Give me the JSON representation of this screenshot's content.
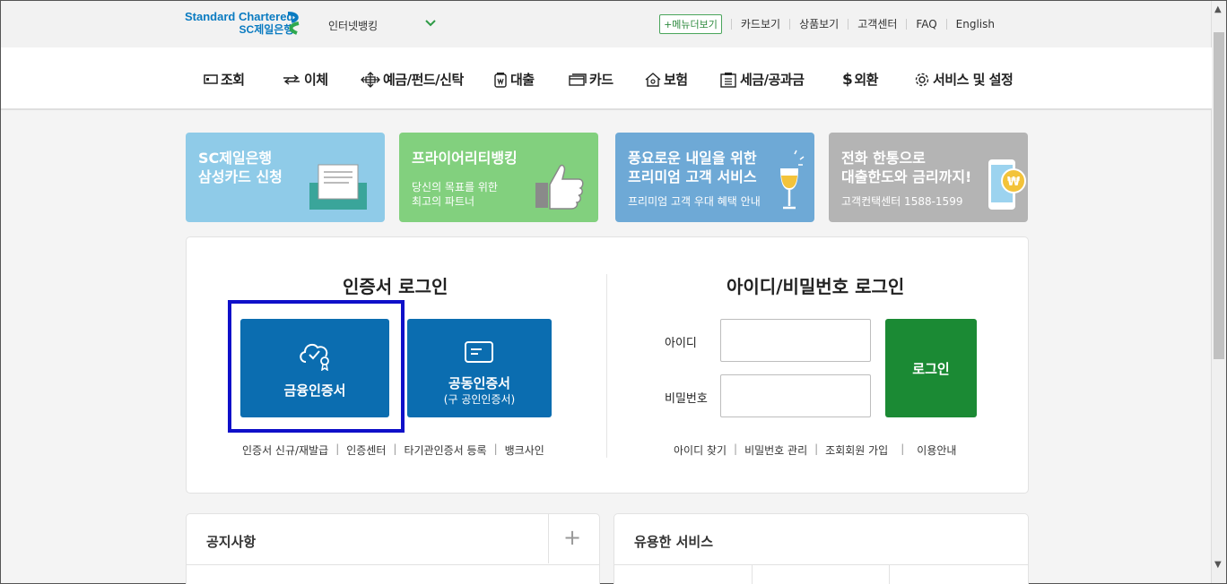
{
  "header": {
    "logo_line1": "Standard Chartered",
    "logo_line2": "SC제일은행",
    "site_select": "인터넷뱅킹",
    "menu_button": "+메뉴더보기",
    "util_links": [
      "카드보기",
      "상품보기",
      "고객센터",
      "FAQ",
      "English"
    ]
  },
  "gnb": [
    {
      "label": "조회",
      "icon": "screen-icon"
    },
    {
      "label": "이체",
      "icon": "transfer-arrows-icon"
    },
    {
      "label": "예금/펀드/신탁",
      "icon": "move-arrows-icon"
    },
    {
      "label": "대출",
      "icon": "won-jar-icon"
    },
    {
      "label": "카드",
      "icon": "card-icon"
    },
    {
      "label": "보험",
      "icon": "house-icon"
    },
    {
      "label": "세금/공과금",
      "icon": "tax-building-icon"
    },
    {
      "label": "외환",
      "icon": "dollar-icon"
    },
    {
      "label": "서비스 및 설정",
      "icon": "gear-icon"
    }
  ],
  "banners": [
    {
      "title1": "SC제일은행",
      "title2": "삼성카드 신청",
      "sub1": "",
      "sub2": "",
      "color": "#8fcbe8"
    },
    {
      "title1": "프라이어리티뱅킹",
      "title2": "",
      "sub1": "당신의 목표를 위한",
      "sub2": "최고의 파트너",
      "color": "#82d07e"
    },
    {
      "title1": "풍요로운 내일을 위한",
      "title2": "프리미엄 고객 서비스",
      "sub1": "프리미엄 고객 우대 혜택 안내",
      "sub2": "",
      "color": "#6ea9d6"
    },
    {
      "title1": "전화 한통으로",
      "title2": "대출한도와 금리까지!",
      "sub1": "고객컨택센터 1588-1599",
      "sub2": "",
      "color": "#b4b4b4"
    }
  ],
  "cert_login": {
    "title": "인증서 로그인",
    "financial_cert": "금융인증서",
    "joint_cert": "공동인증서",
    "joint_cert_sub": "(구 공인인증서)",
    "links": [
      "인증서 신규/재발급",
      "인증센터",
      "타기관인증서 등록",
      "뱅크사인"
    ]
  },
  "id_login": {
    "title": "아이디/비밀번호 로그인",
    "id_label": "아이디",
    "pw_label": "비밀번호",
    "login_button": "로그인",
    "links": [
      "아이디 찾기",
      "비밀번호 관리",
      "조회회원 가입",
      "이용안내"
    ]
  },
  "notice": {
    "title": "공지사항",
    "plus": "+"
  },
  "useful": {
    "title": "유용한 서비스"
  }
}
